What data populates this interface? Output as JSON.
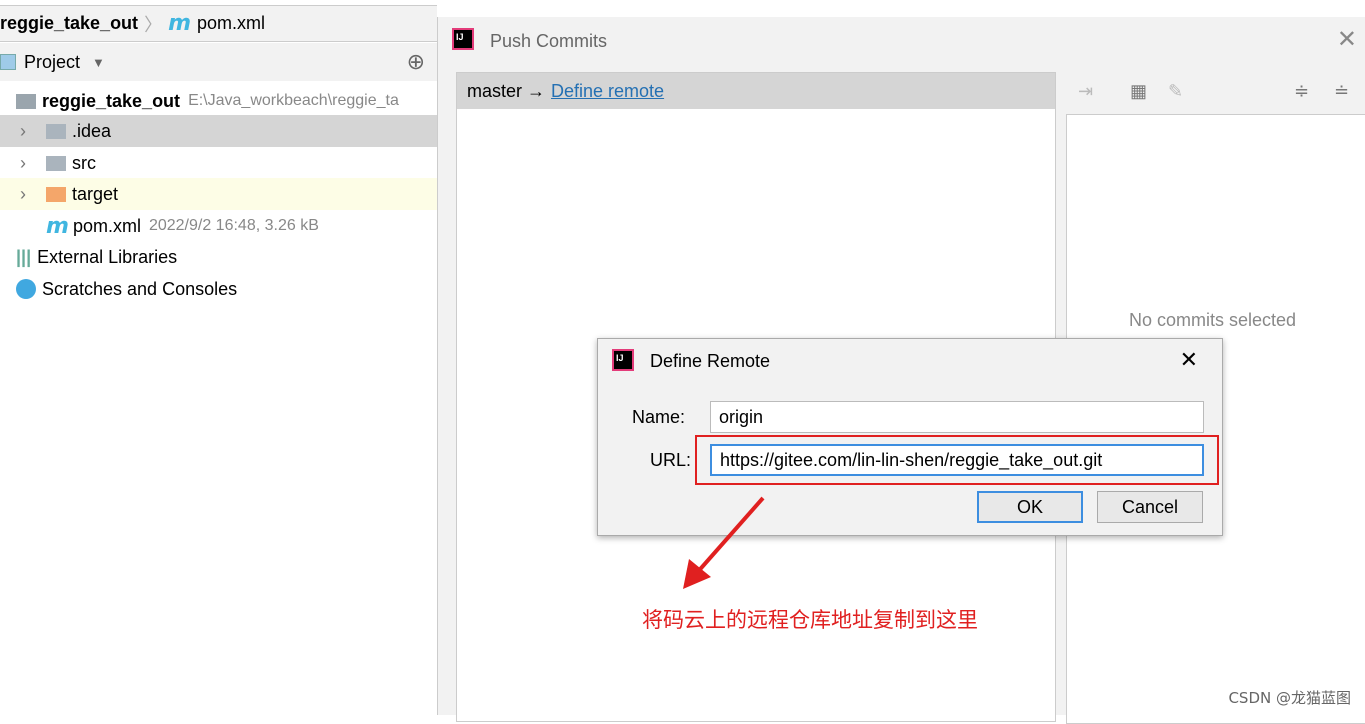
{
  "breadcrumb": {
    "project": "reggie_take_out",
    "file": "pom.xml"
  },
  "project_panel": {
    "title": "Project",
    "root": {
      "name": "reggie_take_out",
      "path": "E:\\Java_workbeach\\reggie_ta"
    },
    "items": [
      {
        "name": ".idea"
      },
      {
        "name": "src"
      },
      {
        "name": "target"
      }
    ],
    "pom": {
      "name": "pom.xml",
      "meta": "2022/9/2 16:48, 3.26 kB"
    },
    "external": "External Libraries",
    "scratches": "Scratches and Consoles"
  },
  "push": {
    "title": "Push Commits",
    "branch": "master →",
    "define_remote": "Define remote",
    "no_commits": "No commits selected"
  },
  "define_remote": {
    "title": "Define Remote",
    "name_label": "Name:",
    "name_value": "origin",
    "url_label": "URL:",
    "url_value": "https://gitee.com/lin-lin-shen/reggie_take_out.git",
    "ok": "OK",
    "cancel": "Cancel"
  },
  "annotation": "将码云上的远程仓库地址复制到这里",
  "watermark": "CSDN @龙猫蓝图",
  "colors": {
    "annotation": "#e02020",
    "link": "#2470b3",
    "selected_row": "#d5d5d5"
  }
}
